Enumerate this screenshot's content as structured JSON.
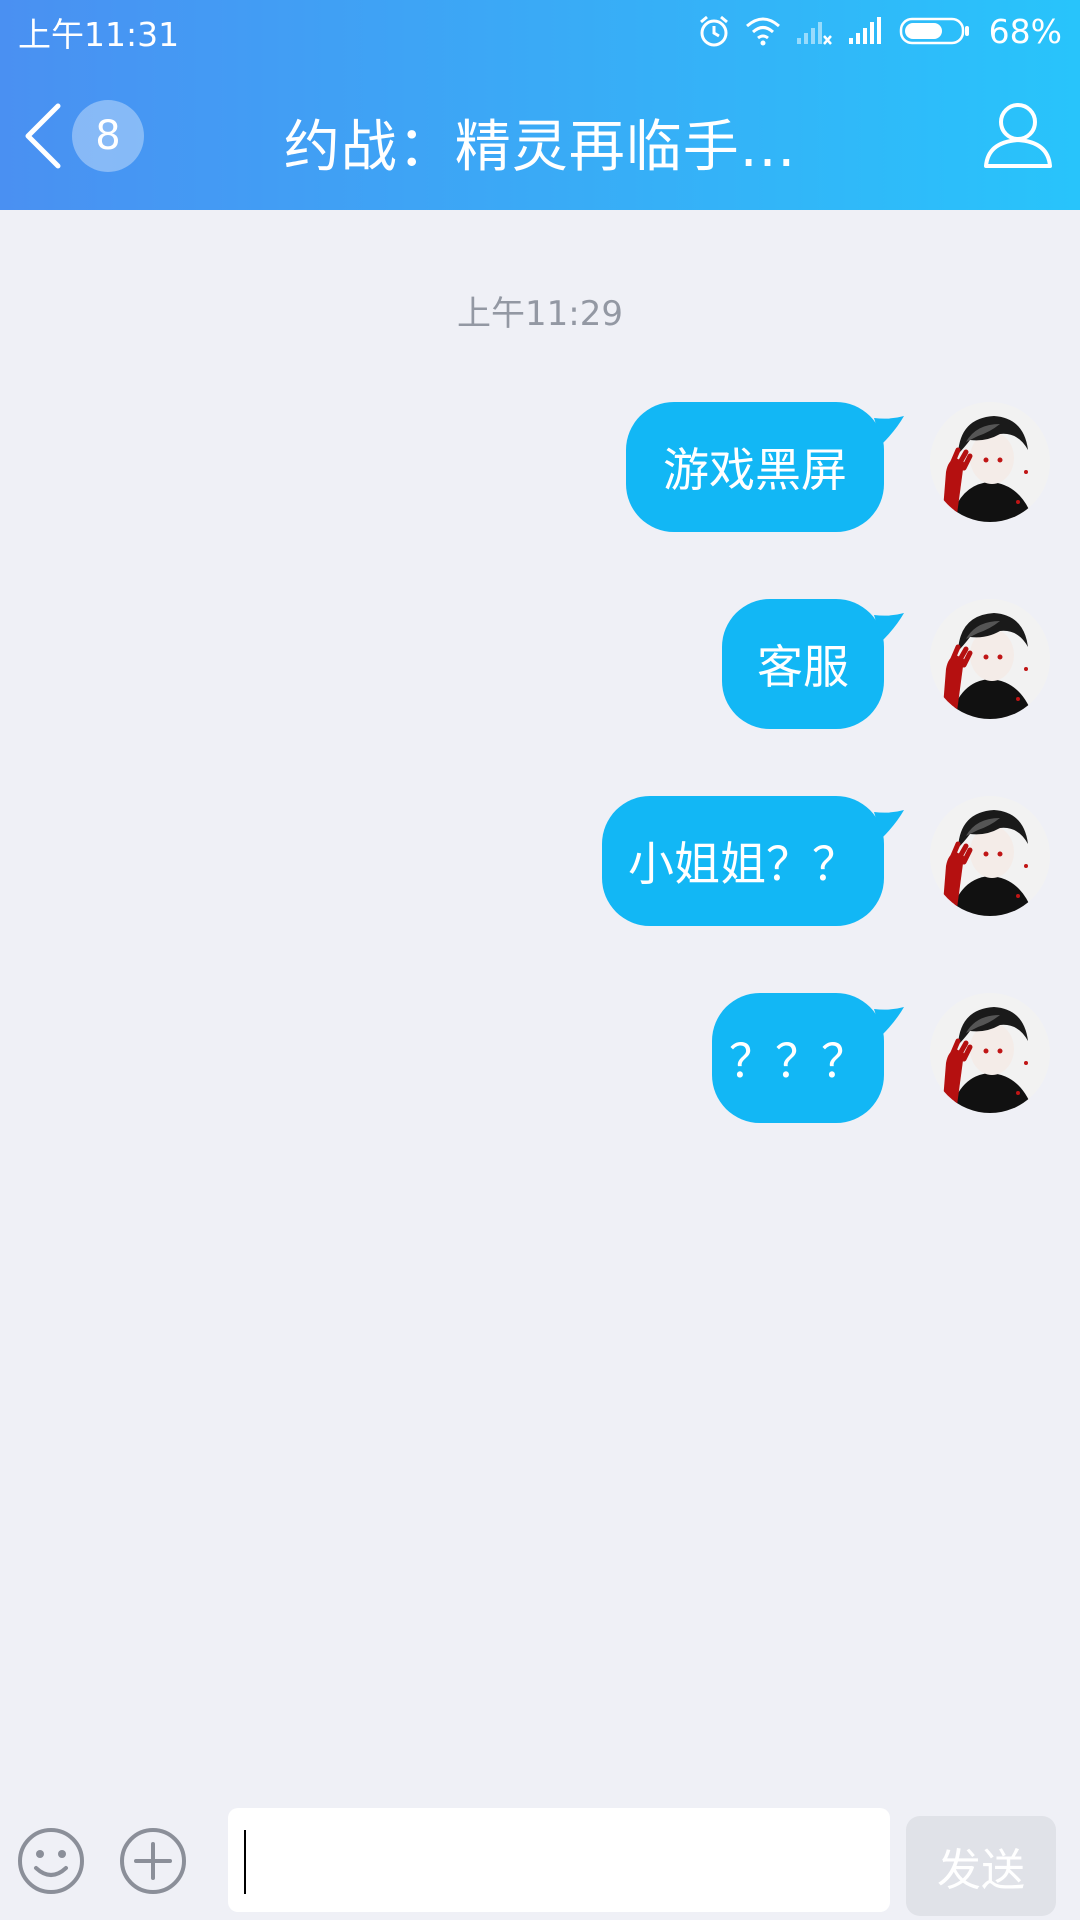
{
  "status_bar": {
    "time": "上午11:31",
    "battery_percent": "68%",
    "battery_level": 0.68,
    "icons": [
      "alarm-icon",
      "wifi-icon",
      "signal-empty-icon",
      "signal-icon",
      "battery-icon"
    ]
  },
  "nav": {
    "unread_count": "8",
    "title": "约战：精灵再临手..."
  },
  "chat": {
    "timestamp": "上午11:29",
    "messages": [
      {
        "text": "游戏黑屏",
        "sender": "me"
      },
      {
        "text": "客服",
        "sender": "me"
      },
      {
        "text": "小姐姐？？",
        "sender": "me"
      },
      {
        "text": "？？？",
        "sender": "me"
      }
    ]
  },
  "input_bar": {
    "text_value": "",
    "send_label": "发送"
  },
  "colors": {
    "header_start": "#4a90f2",
    "header_end": "#28c4fb",
    "bubble": "#12b7f5",
    "background": "#eff0f6",
    "send_disabled": "#e0e2e8"
  }
}
